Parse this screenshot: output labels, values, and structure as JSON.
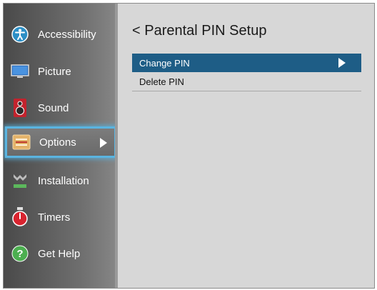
{
  "sidebar": {
    "items": [
      {
        "label": "Accessibility",
        "icon": "accessibility-icon"
      },
      {
        "label": "Picture",
        "icon": "picture-icon"
      },
      {
        "label": "Sound",
        "icon": "speaker-icon"
      },
      {
        "label": "Options",
        "icon": "options-icon",
        "selected": true
      },
      {
        "label": "Installation",
        "icon": "installation-icon"
      },
      {
        "label": "Timers",
        "icon": "timer-icon"
      },
      {
        "label": "Get Help",
        "icon": "help-icon"
      }
    ]
  },
  "main": {
    "title": "< Parental PIN Setup",
    "options": [
      {
        "label": "Change PIN",
        "highlighted": true
      },
      {
        "label": "Delete PIN"
      }
    ]
  },
  "colors": {
    "highlight": "#1e5d86",
    "focus_glow": "#5ab4e0",
    "sidebar_bg": "#6a6a6a",
    "main_bg": "#d7d7d7"
  }
}
